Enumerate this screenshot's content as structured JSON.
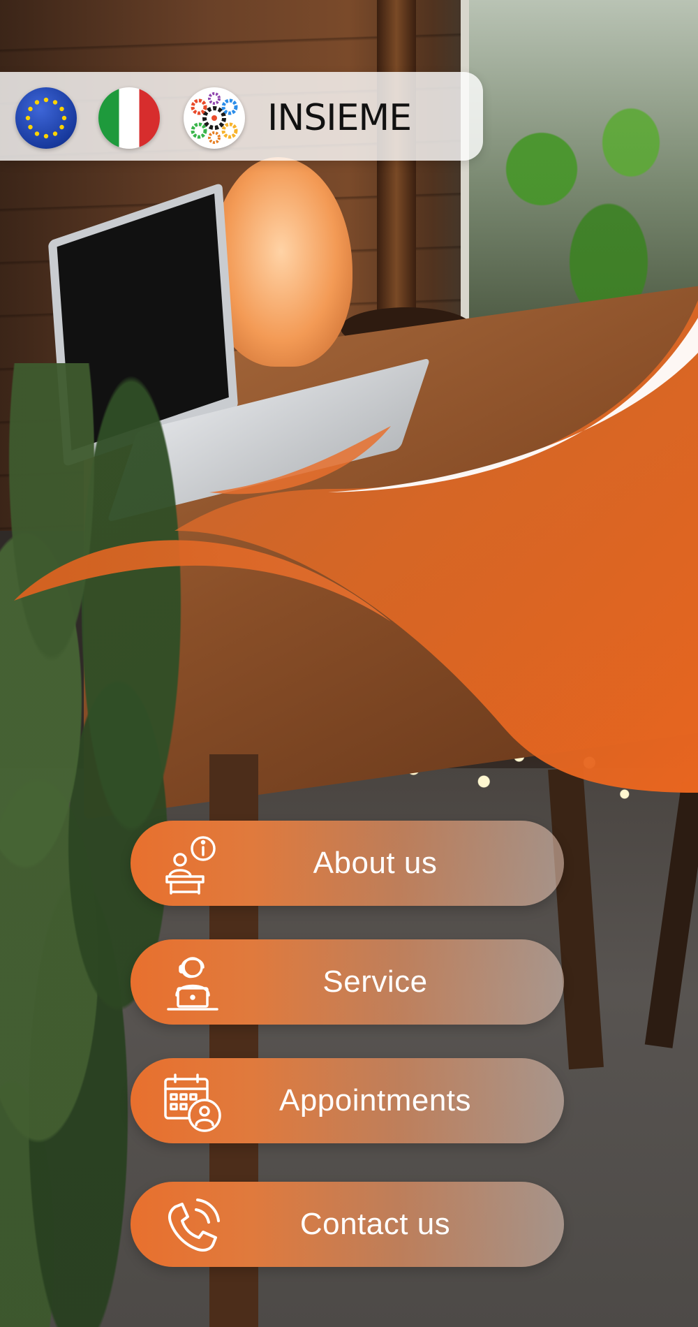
{
  "header": {
    "logos": [
      "eu-flag-icon",
      "italy-flag-icon",
      "gears-people-icon"
    ],
    "brand": "INSIEME"
  },
  "menu": {
    "items": [
      {
        "label": "About us",
        "icon": "desk-info-icon"
      },
      {
        "label": "Service",
        "icon": "support-agent-laptop-icon"
      },
      {
        "label": "Appointments",
        "icon": "calendar-person-icon"
      },
      {
        "label": "Contact us",
        "icon": "phone-call-icon"
      }
    ]
  },
  "colors": {
    "accent": "#E8702E",
    "header_bg": "#FFFFFF",
    "button_text": "#FFFFFF"
  }
}
